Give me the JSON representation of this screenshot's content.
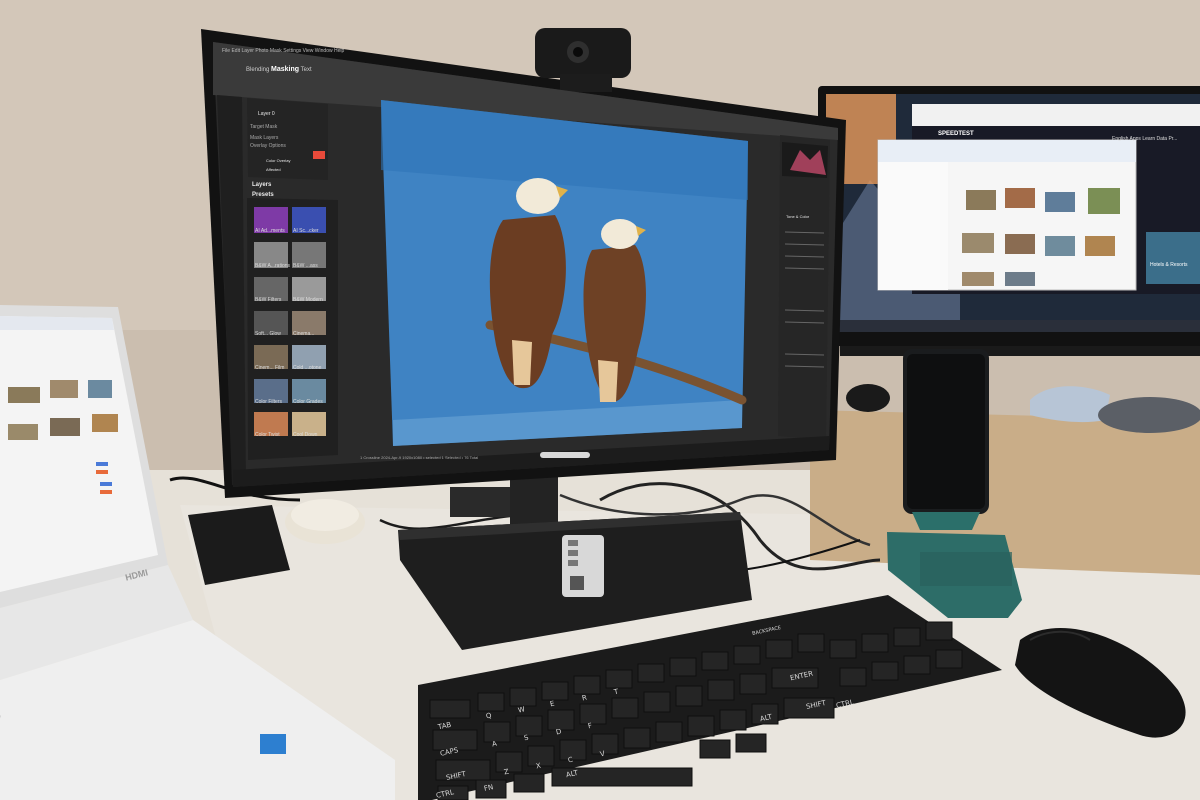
{
  "editor": {
    "menu": [
      "File",
      "Edit",
      "Layer",
      "Photo",
      "Mask",
      "Settings",
      "View",
      "Window",
      "Help"
    ],
    "tabs": [
      "Blending",
      "Masking",
      "Text"
    ],
    "active_tab": "Masking",
    "layer_name": "Layer 0",
    "panel_items": [
      "Target Mask",
      "Mask Layers",
      "Overlay Options"
    ],
    "blend_mode": "Color Overlay",
    "show_mode": "Affected",
    "section_layers": "Layers",
    "section_presets": "Presets",
    "presets": [
      {
        "label": "AI Ad...ments"
      },
      {
        "label": "AI Sc...cker"
      },
      {
        "label": "B&W A...rations"
      },
      {
        "label": "B&W ...ass"
      },
      {
        "label": "B&W Filters"
      },
      {
        "label": "B&W Modern"
      },
      {
        "label": "Soft... Glow"
      },
      {
        "label": "Cinema..."
      },
      {
        "label": "Cinem... Film"
      },
      {
        "label": "Cold ...otone"
      },
      {
        "label": "Color Filters"
      },
      {
        "label": "Color Grades"
      },
      {
        "label": "Color Twist"
      },
      {
        "label": "Cool Down"
      }
    ],
    "right_panel_title": "Tone & Color",
    "status_text": "1 Crossline    2024-Apr-9    1920x1080 • selected    1 Selected • 76 Total"
  },
  "speedtest": {
    "logo": "SPEEDTEST",
    "nav": [
      "English",
      "Apps",
      "Learn",
      "Data",
      "Pr..."
    ],
    "card_title": "Hotels & Resorts"
  },
  "keyboard": {
    "keys": [
      "TAB",
      "CAPS",
      "SHIFT",
      "CTRL",
      "FN",
      "ALT",
      "Q",
      "W",
      "E",
      "R",
      "T",
      "A",
      "S",
      "D",
      "F",
      "Z",
      "X",
      "C",
      "V",
      "ENTER",
      "SHIFT",
      "CTRL",
      "ALT",
      "BACKSPACE"
    ]
  },
  "laptop": {
    "brand_port": "HDMI"
  },
  "colors": {
    "sky": "#3f83c3",
    "editor_bg": "#2b2b2b",
    "accent": "#e84a3a",
    "wall": "#cdbfb0",
    "desk": "#e7e2da"
  }
}
